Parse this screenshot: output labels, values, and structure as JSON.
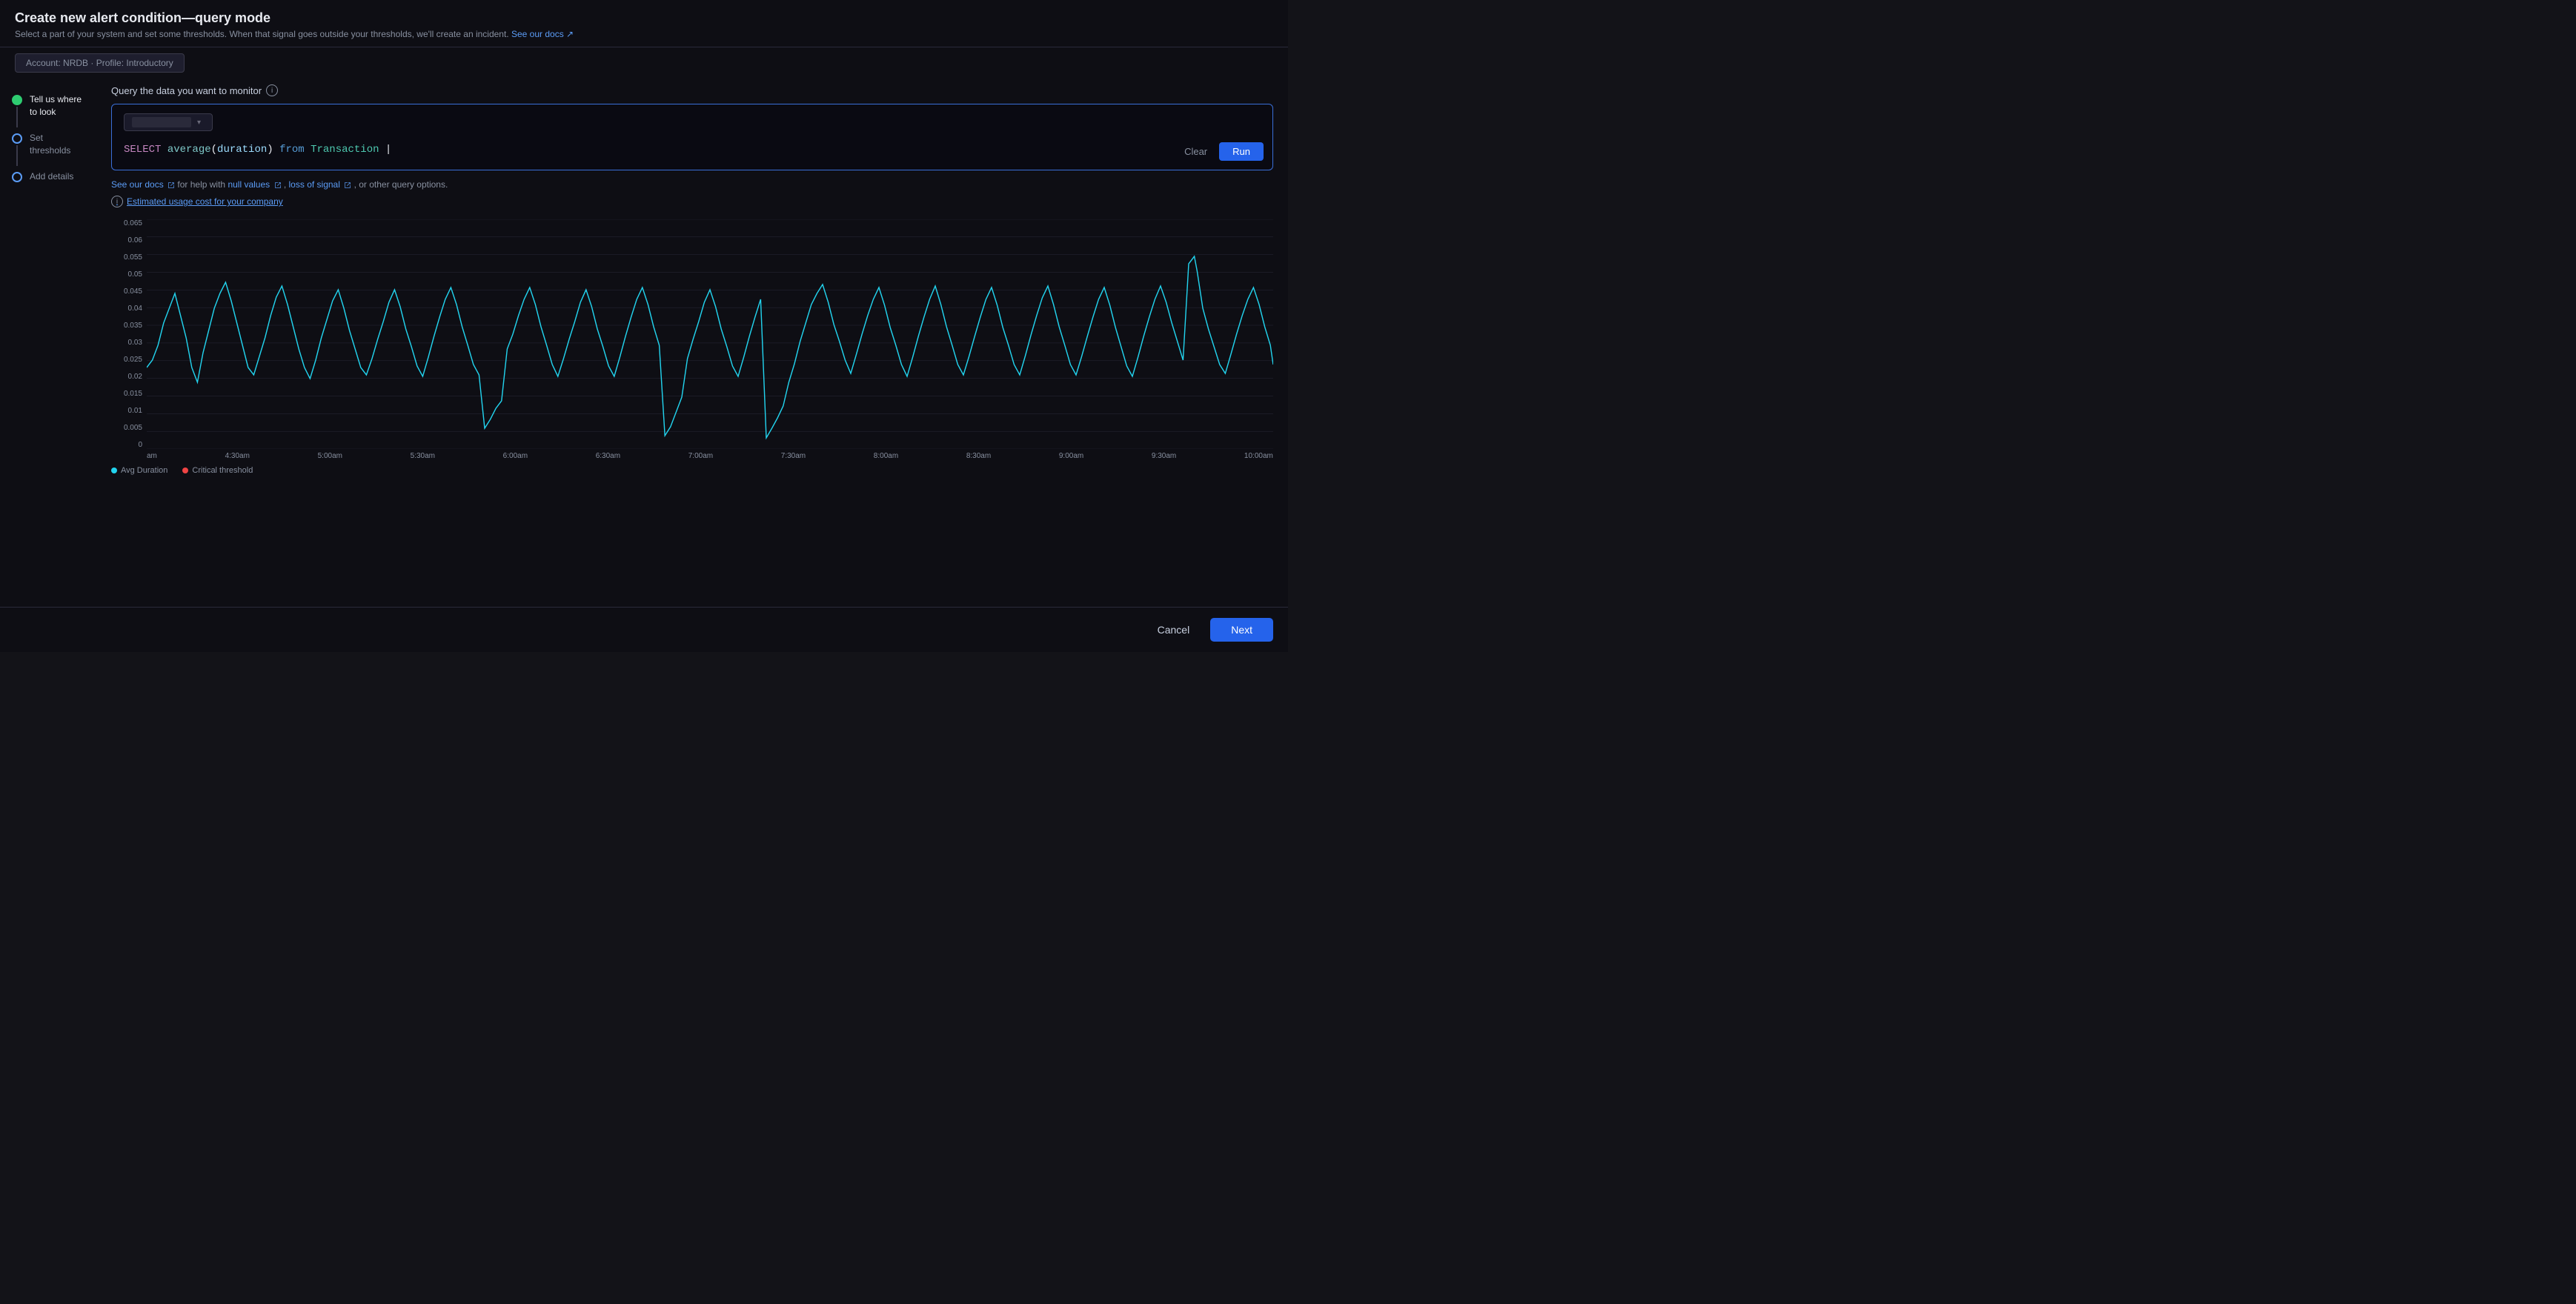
{
  "header": {
    "title": "Create new alert condition—query mode",
    "subtitle": "Select a part of your system and set some thresholds. When that signal goes outside your thresholds, we'll create an incident.",
    "docs_link": "See our docs",
    "tab_label": "Account: NRDB · Profile: Introductory"
  },
  "sidebar": {
    "steps": [
      {
        "id": "tell-us",
        "label": "Tell us where to look",
        "state": "active"
      },
      {
        "id": "set-thresholds",
        "label": "Set thresholds",
        "state": "inactive"
      },
      {
        "id": "add-details",
        "label": "Add details",
        "state": "inactive"
      }
    ]
  },
  "query_section": {
    "label": "Query the data you want to monitor",
    "dropdown_value": "",
    "query_text": "SELECT average(duration) from Transaction",
    "btn_clear": "Clear",
    "btn_run": "Run"
  },
  "help_links": {
    "see_our_docs": "See our docs",
    "null_values": "null values",
    "loss_of_signal": "loss of signal",
    "other_text": ", or other query options."
  },
  "cost_link": "Estimated usage cost for your company",
  "chart": {
    "y_labels": [
      "0.065",
      "0.06",
      "0.055",
      "0.05",
      "0.045",
      "0.04",
      "0.035",
      "0.03",
      "0.025",
      "0.02",
      "0.015",
      "0.01",
      "0.005",
      "0"
    ],
    "x_labels": [
      "am",
      "4:30am",
      "5:00am",
      "5:30am",
      "6:00am",
      "6:30am",
      "7:00am",
      "7:30am",
      "8:00am",
      "8:30am",
      "9:00am",
      "9:30am",
      "10:00am"
    ],
    "legend": [
      {
        "label": "Avg Duration",
        "color": "#22d3ee"
      },
      {
        "label": "Critical threshold",
        "color": "#ef4444"
      }
    ]
  },
  "footer": {
    "cancel_label": "Cancel",
    "next_label": "Next"
  }
}
